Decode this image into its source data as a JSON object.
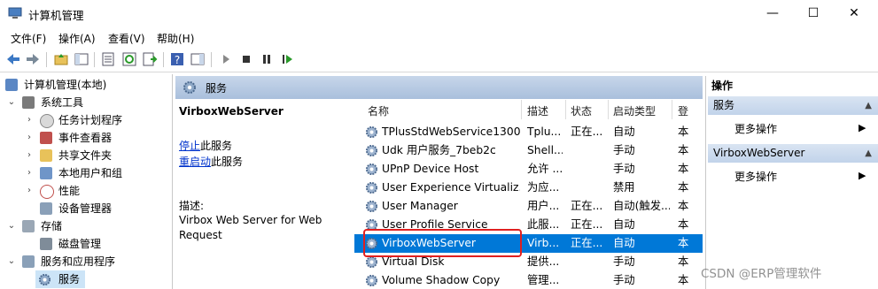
{
  "window": {
    "title": "计算机管理",
    "minimize": "—",
    "maximize": "☐",
    "close": "✕"
  },
  "menu": [
    "文件(F)",
    "操作(A)",
    "查看(V)",
    "帮助(H)"
  ],
  "tree": {
    "items": [
      {
        "label": "计算机管理(本地)",
        "level": 0
      },
      {
        "label": "系统工具",
        "level": 1,
        "twisty": "⌄"
      },
      {
        "label": "任务计划程序",
        "level": 2,
        "twisty": "›"
      },
      {
        "label": "事件查看器",
        "level": 2,
        "twisty": "›"
      },
      {
        "label": "共享文件夹",
        "level": 2,
        "twisty": "›"
      },
      {
        "label": "本地用户和组",
        "level": 2,
        "twisty": "›"
      },
      {
        "label": "性能",
        "level": 2,
        "twisty": "›"
      },
      {
        "label": "设备管理器",
        "level": 2
      },
      {
        "label": "存储",
        "level": 1,
        "twisty": "⌄"
      },
      {
        "label": "磁盘管理",
        "level": 2
      },
      {
        "label": "服务和应用程序",
        "level": 1,
        "twisty": "⌄"
      },
      {
        "label": "服务",
        "level": 2,
        "selected": true
      }
    ]
  },
  "center": {
    "header": "服务",
    "selected_service": "VirboxWebServer",
    "stop_link": "停止",
    "stop_suffix": "此服务",
    "restart_link": "重启动",
    "restart_suffix": "此服务",
    "desc_label": "描述:",
    "description": "Virbox Web Server for Web Request"
  },
  "columns": {
    "name": "名称",
    "desc": "描述",
    "status": "状态",
    "startup": "启动类型",
    "logon": "登"
  },
  "services": [
    {
      "name": "TPlusStdWebService1300",
      "desc": "Tplu...",
      "status": "正在...",
      "startup": "自动",
      "logon": "本"
    },
    {
      "name": "Udk 用户服务_7beb2c",
      "desc": "Shell...",
      "status": "",
      "startup": "手动",
      "logon": "本"
    },
    {
      "name": "UPnP Device Host",
      "desc": "允许 ...",
      "status": "",
      "startup": "手动",
      "logon": "本"
    },
    {
      "name": "User Experience Virtualiz...",
      "desc": "为应...",
      "status": "",
      "startup": "禁用",
      "logon": "本"
    },
    {
      "name": "User Manager",
      "desc": "用户...",
      "status": "正在...",
      "startup": "自动(触发...",
      "logon": "本"
    },
    {
      "name": "User Profile Service",
      "desc": "此服...",
      "status": "正在...",
      "startup": "自动",
      "logon": "本"
    },
    {
      "name": "VirboxWebServer",
      "desc": "Virb...",
      "status": "正在...",
      "startup": "自动",
      "logon": "本",
      "selected": true
    },
    {
      "name": "Virtual Disk",
      "desc": "提供...",
      "status": "",
      "startup": "手动",
      "logon": "本"
    },
    {
      "name": "Volume Shadow Copy",
      "desc": "管理...",
      "status": "",
      "startup": "手动",
      "logon": "本"
    }
  ],
  "actions": {
    "title": "操作",
    "groups": [
      {
        "header": "服务",
        "item": "更多操作"
      },
      {
        "header": "VirboxWebServer",
        "item": "更多操作"
      }
    ]
  },
  "watermark": "CSDN @ERP管理软件",
  "colors": {
    "selection": "#0078d7",
    "highlight_box": "#e02020",
    "link": "#0033cc"
  }
}
